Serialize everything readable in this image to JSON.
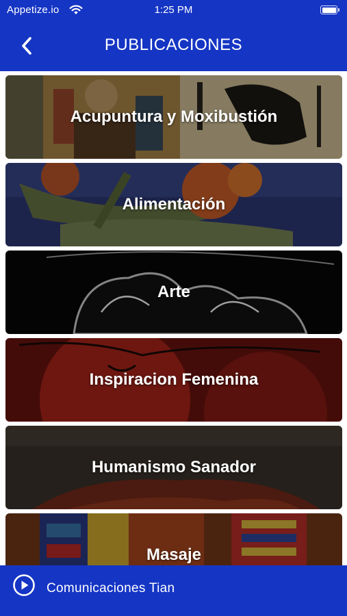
{
  "status_bar": {
    "carrier": "Appetize.io",
    "time": "1:25 PM",
    "wifi_icon": "wifi-icon",
    "battery_icon": "battery-icon"
  },
  "nav": {
    "back_icon": "chevron-left-icon",
    "title": "PUBLICACIONES"
  },
  "publications": [
    {
      "label": "Acupuntura y Moxibustión",
      "image": "calligraphy-figure-artwork"
    },
    {
      "label": "Alimentación",
      "image": "vegetables-photo"
    },
    {
      "label": "Arte",
      "image": "ink-drawing-artwork"
    },
    {
      "label": "Inspiracion Femenina",
      "image": "red-sketch-artwork"
    },
    {
      "label": "Humanismo Sanador",
      "image": "book-cover-artwork"
    },
    {
      "label": "Masaje",
      "image": "colorful-painting-artwork"
    }
  ],
  "bottom_bar": {
    "play_icon": "play-circle-icon",
    "label": "Comunicaciones Tian"
  },
  "colors": {
    "brand_blue": "#1535c4",
    "text": "#ffffff"
  }
}
